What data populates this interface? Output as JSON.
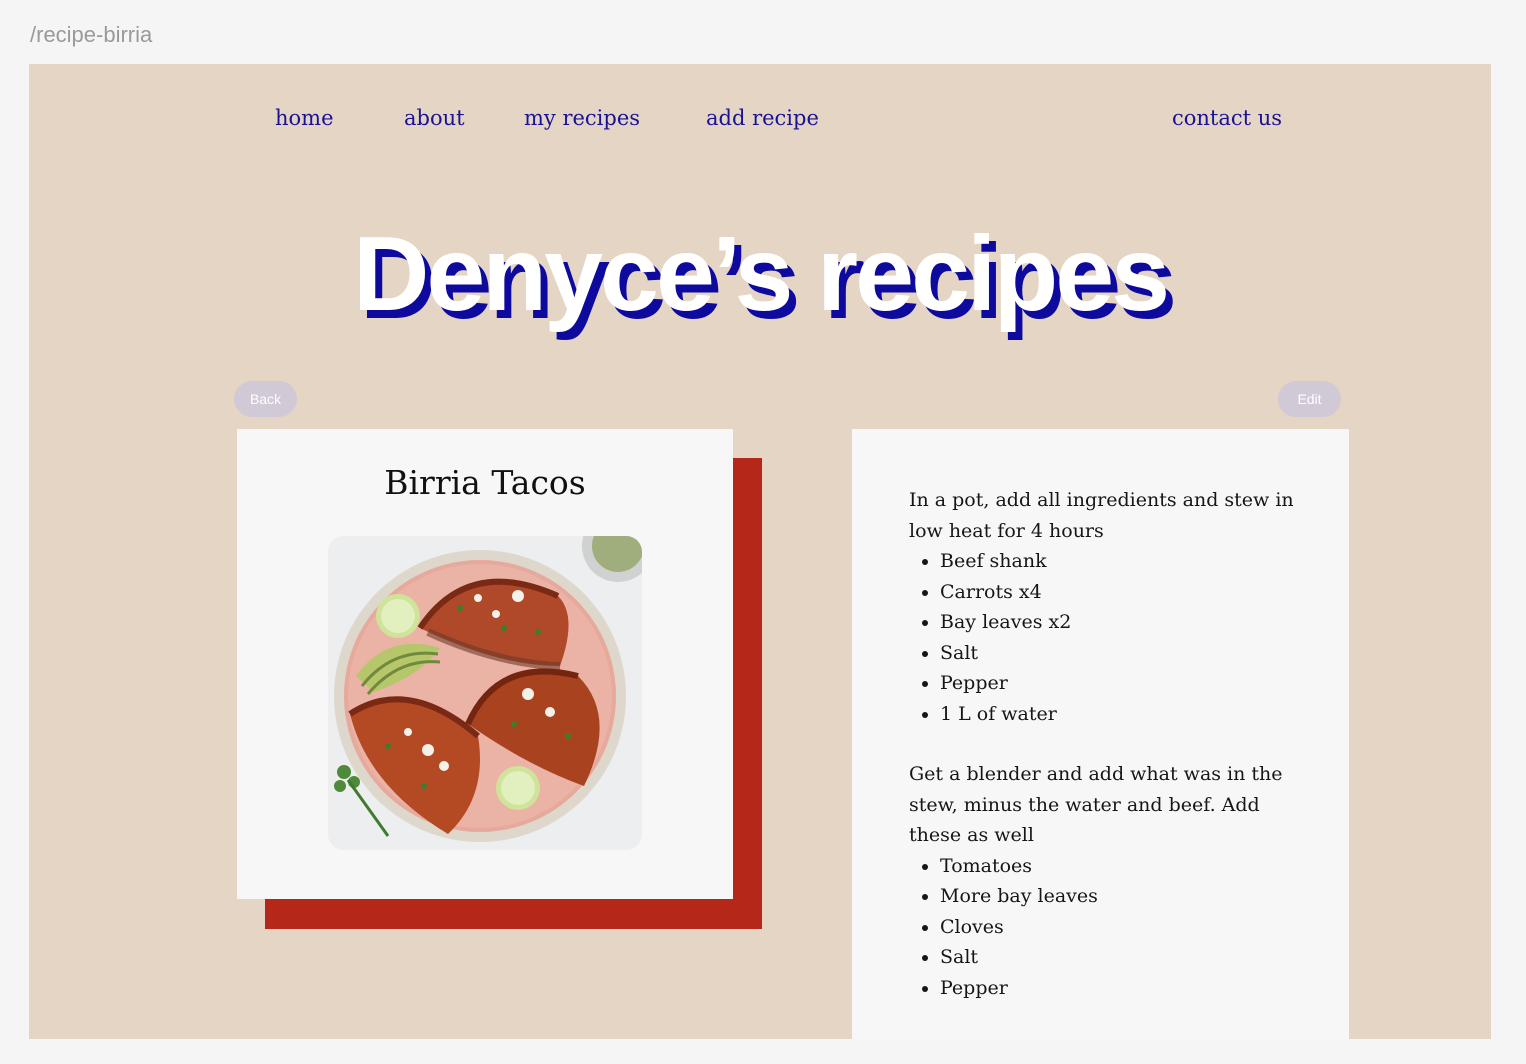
{
  "frame": {
    "label": "/recipe-birria"
  },
  "nav": {
    "home": "home",
    "about": "about",
    "my_recipes": "my recipes",
    "add_recipe": "add recipe",
    "contact_us": "contact us"
  },
  "hero": {
    "title": "Denyce’s recipes"
  },
  "actions": {
    "back_label": "Back",
    "edit_label": "Edit"
  },
  "recipe": {
    "title": "Birria Tacos",
    "image_alt": "plate of birria tacos with avocado and lime"
  },
  "instructions": {
    "step1": "In a pot, add all ingredients and stew in low heat for 4 hours",
    "step1_items": [
      "Beef shank",
      "Carrots x4",
      "Bay leaves x2",
      "Salt",
      "Pepper",
      "1 L of water"
    ],
    "step2": "Get a blender and add what was in the stew, minus the water and beef. Add these as well",
    "step2_items": [
      "Tomatoes",
      "More bay leaves",
      "Cloves",
      "Salt",
      "Pepper"
    ]
  },
  "colors": {
    "background": "#e4d5c4",
    "nav_text": "#1a1296",
    "accent_red": "#b52819",
    "hero_shadow": "#0f0a9e",
    "pill": "#d1c9d6"
  }
}
